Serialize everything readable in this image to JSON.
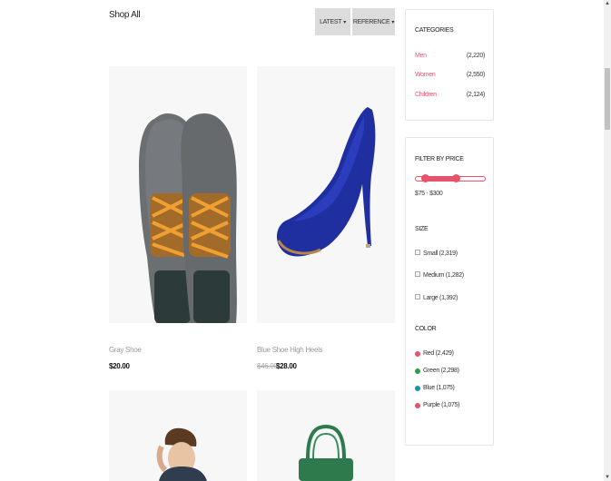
{
  "header": {
    "title": "Shop All"
  },
  "sort": {
    "latest_label": "LATEST",
    "reference_label": "REFERENCE"
  },
  "products": [
    {
      "name": "Gray Shoe",
      "price": "$20.00"
    },
    {
      "name": "Blue Shoe High Heels",
      "old_price": "$46.00",
      "price": "$28.00"
    },
    {
      "name": "",
      "price": ""
    },
    {
      "name": "",
      "price": ""
    }
  ],
  "categories": {
    "title": "CATEGORIES",
    "items": [
      {
        "label": "Men",
        "count": "(2,220)"
      },
      {
        "label": "Women",
        "count": "(2,550)"
      },
      {
        "label": "Children",
        "count": "(2,124)"
      }
    ]
  },
  "filters": {
    "price_title": "FILTER BY PRICE",
    "price_range": "$75 - $300",
    "price_min_fraction": 0.14,
    "price_max_fraction": 0.58,
    "size_title": "SIZE",
    "sizes": [
      {
        "label": "Small (2,319)"
      },
      {
        "label": "Medium (1,282)"
      },
      {
        "label": "Large (1,392)"
      }
    ],
    "color_title": "COLOR",
    "colors": [
      {
        "label": "Red (2,429)",
        "color": "#e8536b"
      },
      {
        "label": "Green (2,298)",
        "color": "#2a9d4b"
      },
      {
        "label": "Blue (1,075)",
        "color": "#1b8fb0"
      },
      {
        "label": "Purple (1,075)",
        "color": "#e8536b"
      }
    ]
  },
  "theme": {
    "accent": "#e8536b",
    "button_bg": "#dcdcdc",
    "photo_bg": "#f7f7f7"
  }
}
